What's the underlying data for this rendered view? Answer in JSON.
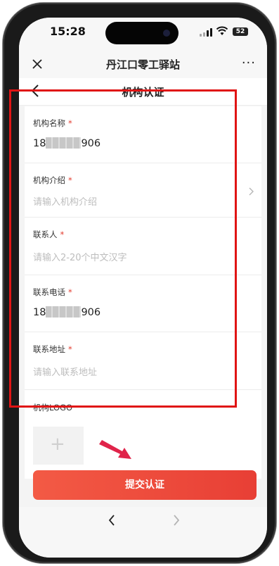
{
  "status": {
    "time": "15:28",
    "battery": "52"
  },
  "titlebar": {
    "title": "丹江口零工驿站",
    "more": "···"
  },
  "navbar": {
    "title": "机构认证"
  },
  "form": {
    "fields": [
      {
        "label": "机构名称",
        "required": "*",
        "value_prefix": "18",
        "value_suffix": "906"
      },
      {
        "label": "机构介绍",
        "required": "*",
        "placeholder": "请输入机构介绍"
      },
      {
        "label": "联系人",
        "required": "*",
        "placeholder": "请输入2-20个中文汉字"
      },
      {
        "label": "联系电话",
        "required": "*",
        "value_prefix": "18",
        "value_suffix": "906"
      },
      {
        "label": "联系地址",
        "required": "*",
        "placeholder": "请输入联系地址"
      },
      {
        "label": "机构LOGO"
      }
    ]
  },
  "upload": {
    "plus": "+"
  },
  "submit_label": "提交认证",
  "colors": {
    "accent": "#e83f35",
    "highlight_box": "#e01414",
    "required": "#e33b2e"
  }
}
